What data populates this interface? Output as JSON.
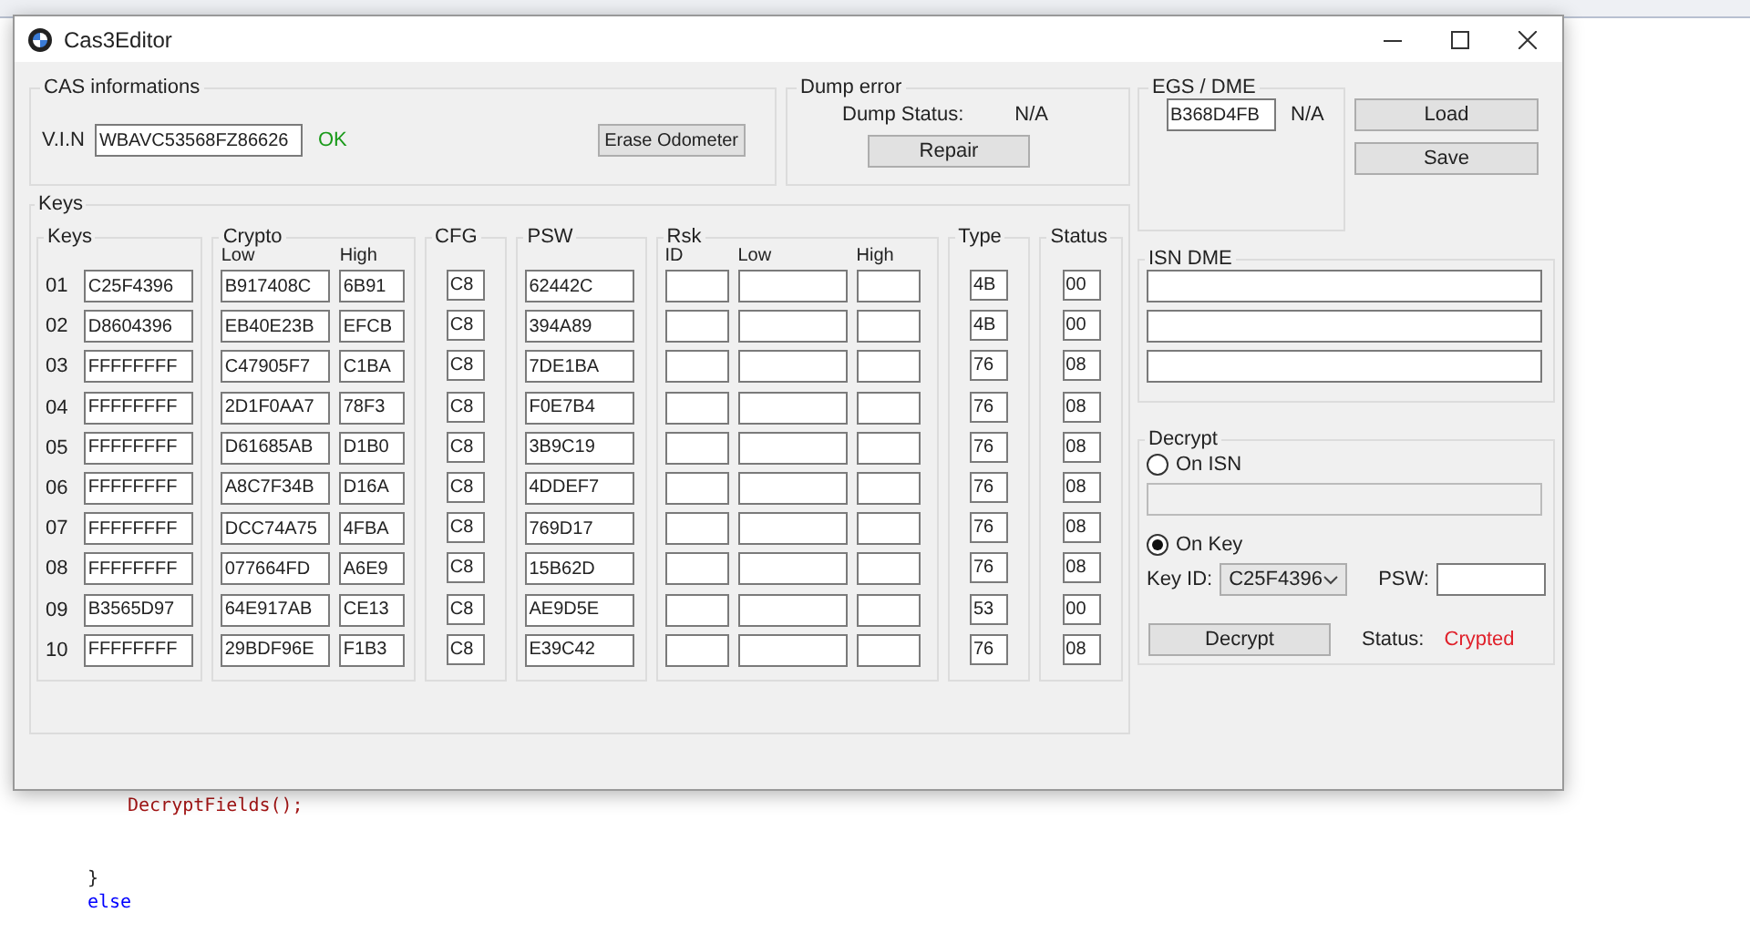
{
  "editor": {
    "code_lines": [
      {
        "kind": "call",
        "text": "DecryptFields();"
      },
      {
        "kind": "brace",
        "text": "}"
      },
      {
        "kind": "keyword",
        "text": "else"
      }
    ]
  },
  "window": {
    "title": "Cas3Editor"
  },
  "cas_info": {
    "title": "CAS informations",
    "vin_label": "V.I.N",
    "vin": "WBAVC53568FZ86626",
    "vin_status": "OK",
    "erase_button": "Erase Odometer"
  },
  "dump_error": {
    "title": "Dump error",
    "status_label": "Dump Status:",
    "status": "N/A",
    "repair_button": "Repair"
  },
  "egs_dme": {
    "title": "EGS / DME",
    "value": "B368D4FB",
    "status": "N/A"
  },
  "buttons": [
    "Load",
    "Save"
  ],
  "keys": {
    "title": "Keys",
    "keys_header": "Keys",
    "crypto_header": "Crypto",
    "crypto_low": "Low",
    "crypto_high": "High",
    "cfg_header": "CFG",
    "psw_header": "PSW",
    "rsk_header": "Rsk",
    "rsk_id": "ID",
    "rsk_low": "Low",
    "rsk_high": "High",
    "type_header": "Type",
    "status_header": "Status",
    "rows": [
      {
        "index": "01",
        "key": "C25F4396",
        "low": "B917408C",
        "high": "6B91",
        "cfg": "C8",
        "psw": "62442C",
        "type": "4B",
        "status": "00"
      },
      {
        "index": "02",
        "key": "D8604396",
        "low": "EB40E23B",
        "high": "EFCB",
        "cfg": "C8",
        "psw": "394A89",
        "type": "4B",
        "status": "00"
      },
      {
        "index": "03",
        "key": "FFFFFFFF",
        "low": "C47905F7",
        "high": "C1BA",
        "cfg": "C8",
        "psw": "7DE1BA",
        "type": "76",
        "status": "08"
      },
      {
        "index": "04",
        "key": "FFFFFFFF",
        "low": "2D1F0AA7",
        "high": "78F3",
        "cfg": "C8",
        "psw": "F0E7B4",
        "type": "76",
        "status": "08"
      },
      {
        "index": "05",
        "key": "FFFFFFFF",
        "low": "D61685AB",
        "high": "D1B0",
        "cfg": "C8",
        "psw": "3B9C19",
        "type": "76",
        "status": "08"
      },
      {
        "index": "06",
        "key": "FFFFFFFF",
        "low": "A8C7F34B",
        "high": "D16A",
        "cfg": "C8",
        "psw": "4DDEF7",
        "type": "76",
        "status": "08"
      },
      {
        "index": "07",
        "key": "FFFFFFFF",
        "low": "DCC74A75",
        "high": "4FBA",
        "cfg": "C8",
        "psw": "769D17",
        "type": "76",
        "status": "08"
      },
      {
        "index": "08",
        "key": "FFFFFFFF",
        "low": "077664FD",
        "high": "A6E9",
        "cfg": "C8",
        "psw": "15B62D",
        "type": "76",
        "status": "08"
      },
      {
        "index": "09",
        "key": "B3565D97",
        "low": "64E917AB",
        "high": "CE13",
        "cfg": "C8",
        "psw": "AE9D5E",
        "type": "53",
        "status": "00"
      },
      {
        "index": "10",
        "key": "FFFFFFFF",
        "low": "29BDF96E",
        "high": "F1B3",
        "cfg": "C8",
        "psw": "E39C42",
        "type": "76",
        "status": "08"
      }
    ]
  },
  "isn_dme": {
    "title": "ISN DME"
  },
  "decrypt": {
    "title": "Decrypt",
    "options": [
      {
        "label": "On ISN",
        "selected": false
      },
      {
        "label": "On Key",
        "selected": true
      }
    ],
    "key_id_label": "Key ID:",
    "key_id": "C25F4396",
    "psw_label": "PSW:",
    "button": "Decrypt",
    "status_label": "Status:",
    "status": "Crypted"
  }
}
